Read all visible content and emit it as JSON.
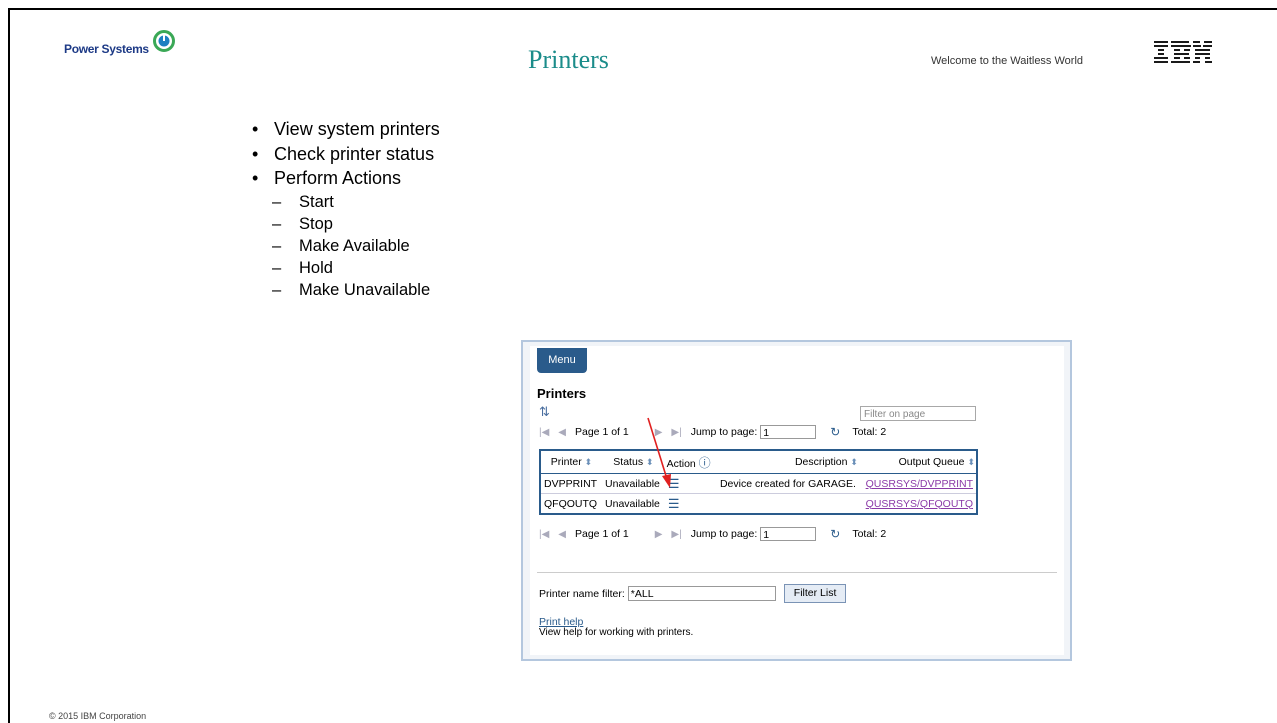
{
  "header": {
    "brand": "Power Systems",
    "title": "Printers",
    "tagline": "Welcome to the Waitless World",
    "logo_text": "IBM"
  },
  "bullets": [
    "View system printers",
    "Check printer status",
    "Perform Actions"
  ],
  "sub_bullets": [
    "Start",
    "Stop",
    "Make Available",
    "Hold",
    "Make Unavailable"
  ],
  "panel": {
    "menu_label": "Menu",
    "heading": "Printers",
    "filter_placeholder": "Filter on page",
    "pager_top": {
      "page_label": "Page 1 of 1",
      "jump_label": "Jump to page:",
      "jump_value": "1",
      "total": "Total: 2"
    },
    "pager_bottom": {
      "page_label": "Page 1 of 1",
      "jump_label": "Jump to page:",
      "jump_value": "1",
      "total": "Total: 2"
    },
    "columns": [
      "Printer",
      "Status",
      "Action",
      "Description",
      "Output Queue"
    ],
    "rows": [
      {
        "printer": "DVPPRINT",
        "status": "Unavailable",
        "description": "Device created for GARAGE.",
        "output_queue": "QUSRSYS/DVPPRINT"
      },
      {
        "printer": "QFQOUTQ",
        "status": "Unavailable",
        "description": "",
        "output_queue": "QUSRSYS/QFQOUTQ"
      }
    ],
    "name_filter_label": "Printer name filter:",
    "name_filter_value": "*ALL",
    "filter_button": "Filter List",
    "print_help_link": "Print help",
    "help_text": "View help for working with printers."
  },
  "footer": "© 2015 IBM Corporation",
  "colors": {
    "title": "#1b8c8a",
    "accent": "#2a5b8b",
    "link": "#8b3aa8",
    "arrow": "#e02020"
  }
}
